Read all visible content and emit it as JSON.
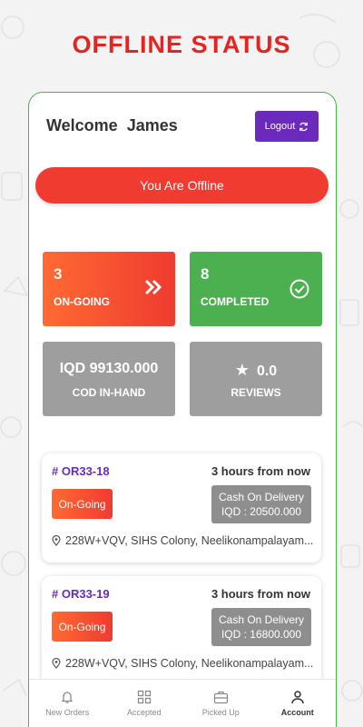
{
  "banner": "OFFLINE STATUS",
  "header": {
    "welcome": "Welcome  James",
    "logout_label": "Logout"
  },
  "offline_button": "You Are Offline",
  "stats": {
    "ongoing": {
      "count": "3",
      "label": "ON-GOING"
    },
    "completed": {
      "count": "8",
      "label": "COMPLETED"
    },
    "cod": {
      "amount": "IQD 99130.000",
      "label": "COD IN-HAND"
    },
    "reviews": {
      "rating": "0.0",
      "label": "REVIEWS"
    }
  },
  "orders": [
    {
      "id": "# OR33-18",
      "time": "3 hours from now",
      "status": "On-Going",
      "payment_method": "Cash On Delivery",
      "amount": "IQD : 20500.000",
      "address": "228W+VQV, SIHS Colony, Neelikonampalayam..."
    },
    {
      "id": "# OR33-19",
      "time": "3 hours from now",
      "status": "On-Going",
      "payment_method": "Cash On Delivery",
      "amount": "IQD : 16800.000",
      "address": "228W+VQV, SIHS Colony, Neelikonampalayam..."
    }
  ],
  "nav": {
    "items": [
      {
        "label": "New Orders",
        "icon": "bell-icon"
      },
      {
        "label": "Accepted",
        "icon": "grid-icon"
      },
      {
        "label": "Picked Up",
        "icon": "briefcase-icon"
      },
      {
        "label": "Account",
        "icon": "user-icon"
      }
    ],
    "active": "Account"
  },
  "colors": {
    "brand_red": "#e8231f",
    "offline_red": "#ef3b30",
    "purple": "#6a2bbd",
    "green": "#4cb050",
    "gray": "#9e9e9e"
  }
}
